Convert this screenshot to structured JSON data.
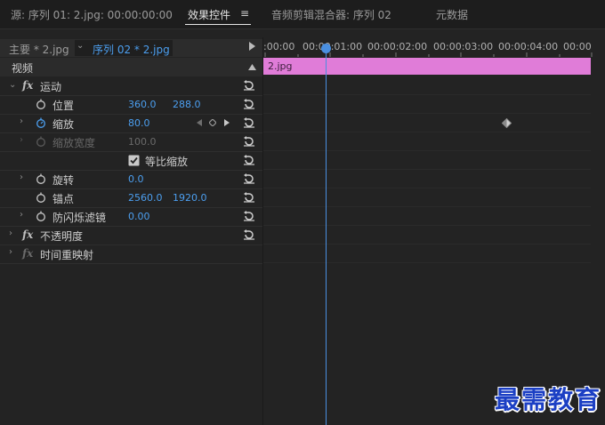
{
  "tabs": [
    {
      "label": "源: 序列 01: 2.jpg: 00:00:00:00"
    },
    {
      "label": "效果控件"
    },
    {
      "label": "音频剪辑混合器: 序列 02"
    },
    {
      "label": "元数据"
    }
  ],
  "tab_menu_icon": "≡",
  "clip_header": {
    "master": "主要 * 2.jpg",
    "sequence": "序列 02 * 2.jpg"
  },
  "section_label": "视频",
  "effects": {
    "motion": {
      "name": "运动",
      "position": {
        "label": "位置",
        "x": "360.0",
        "y": "288.0"
      },
      "scale": {
        "label": "缩放",
        "value": "80.0"
      },
      "scale_width": {
        "label": "缩放宽度",
        "value": "100.0"
      },
      "uniform_scale": {
        "label": "等比缩放",
        "checked": true
      },
      "rotation": {
        "label": "旋转",
        "value": "0.0"
      },
      "anchor": {
        "label": "锚点",
        "x": "2560.0",
        "y": "1920.0"
      },
      "antiflicker": {
        "label": "防闪烁滤镜",
        "value": "0.00"
      }
    },
    "opacity": {
      "name": "不透明度"
    },
    "time_remap": {
      "name": "时间重映射"
    }
  },
  "fx_label": "fx",
  "timeline": {
    "ticks": [
      ":00:00",
      "00:00:01:00",
      "00:00:02:00",
      "00:00:03:00",
      "00:00:04:00",
      "00:00"
    ],
    "clip_name": "2.jpg"
  },
  "watermark": "最需教育",
  "colors": {
    "accent": "#4c9ff0",
    "clip": "#e07cd8",
    "playhead": "#4a8fe0"
  }
}
